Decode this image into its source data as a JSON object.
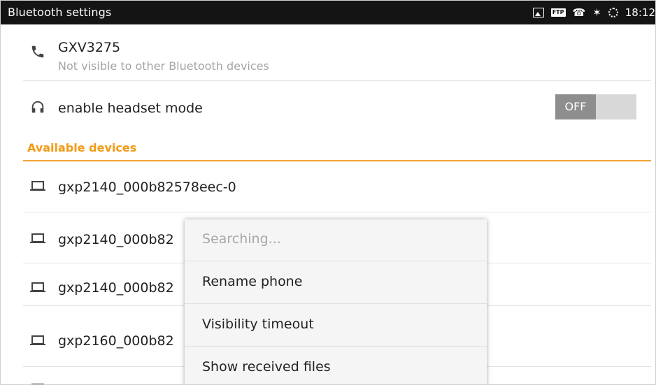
{
  "status_bar": {
    "title": "Bluetooth settings",
    "time": "18:12",
    "ftp": "FTP",
    "bluetooth_glyph": "✶",
    "phone_glyph": "☎"
  },
  "device": {
    "name": "GXV3275",
    "visibility": "Not visible to other Bluetooth devices"
  },
  "headset": {
    "label": "enable headset mode",
    "toggle": "OFF"
  },
  "available_devices_header": "Available devices",
  "devices": [
    "gxp2140_000b82578eec-0",
    "gxp2140_000b82",
    "gxp2140_000b82",
    "gxp2160_000b82"
  ],
  "menu": {
    "items": [
      "Searching...",
      "Rename phone",
      "Visibility timeout",
      "Show received files"
    ]
  },
  "colors": {
    "accent": "#f29b16",
    "statusbar": "#141414"
  },
  "icons": {
    "phone": "phone-icon",
    "headset": "headset-icon",
    "laptop": "laptop-icon"
  }
}
